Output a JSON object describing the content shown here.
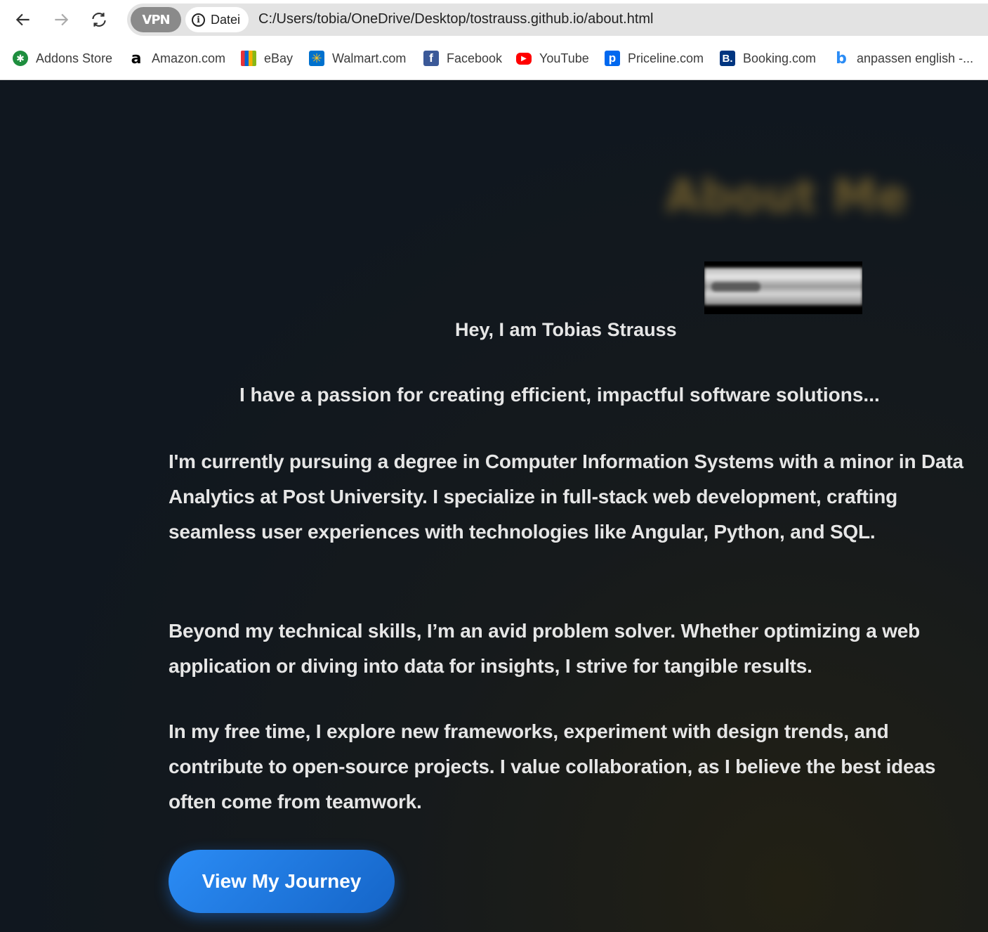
{
  "browser": {
    "vpn_label": "VPN",
    "security_label": "Datei",
    "url": "C:/Users/tobia/OneDrive/Desktop/tostrauss.github.io/about.html"
  },
  "bookmarks": [
    {
      "label": "Addons Store",
      "icon": "addons-store-icon",
      "color": "#1e8e3e"
    },
    {
      "label": "Amazon.com",
      "icon": "amazon-icon",
      "color": "#000000"
    },
    {
      "label": "eBay",
      "icon": "ebay-icon",
      "color": "#e53238"
    },
    {
      "label": "Walmart.com",
      "icon": "walmart-icon",
      "color": "#0071ce"
    },
    {
      "label": "Facebook",
      "icon": "facebook-icon",
      "color": "#3b5998"
    },
    {
      "label": "YouTube",
      "icon": "youtube-icon",
      "color": "#ff0000"
    },
    {
      "label": "Priceline.com",
      "icon": "priceline-icon",
      "color": "#0068ef"
    },
    {
      "label": "Booking.com",
      "icon": "booking-icon",
      "color": "#003580"
    },
    {
      "label": "anpassen english -...",
      "icon": "bing-icon",
      "color": "#2b8cf5"
    }
  ],
  "page": {
    "title": "About Me",
    "greeting": "Hey, I am Tobias Strauss",
    "tagline": "I have a passion for creating efficient, impactful software solutions...",
    "paragraphs": [
      "I'm currently pursuing a degree in Computer Information Systems with a minor in Data Analytics at Post University. I specialize in full-stack web development, crafting seamless user experiences with technologies like Angular, Python, and SQL.",
      "Beyond my technical skills, I’m an avid problem solver. Whether optimizing a web application or diving into data for insights, I strive for tangible results.",
      "In my free time, I explore new frameworks, experiment with design trends, and contribute to open-source projects. I value collaboration, as I believe the best ideas often come from teamwork."
    ],
    "cta_label": "View My Journey",
    "accent_color": "#1e7ae6"
  }
}
